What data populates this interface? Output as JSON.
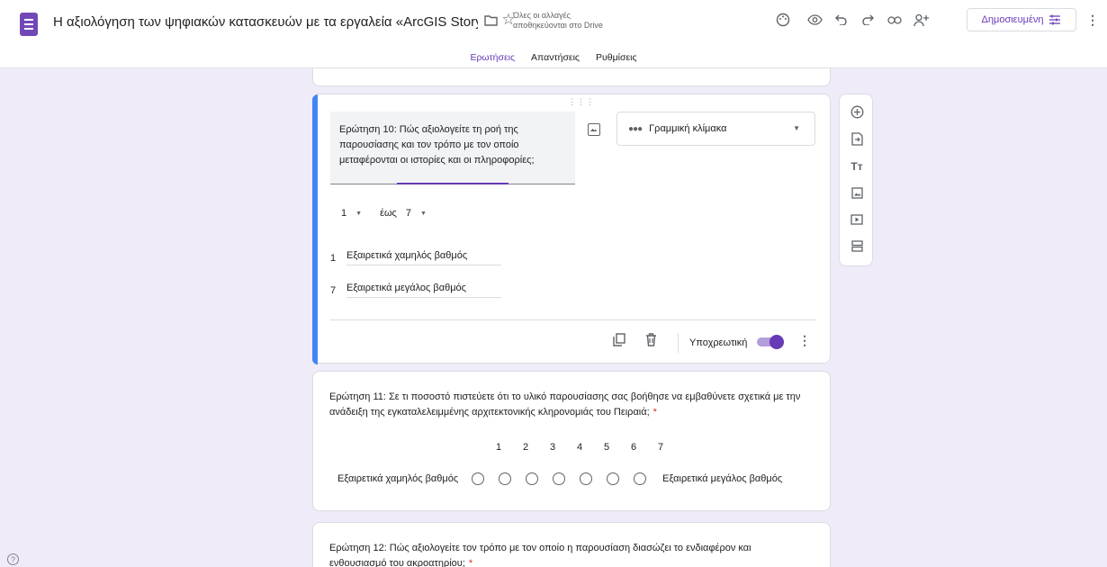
{
  "header": {
    "title": "Η αξιολόγηση των ψηφιακών κατασκευών με τα εργαλεία «ArcGIS Story",
    "save_status_line1": "Όλες οι αλλαγές",
    "save_status_line2": "αποθηκεύονται στο Drive",
    "publish_label": "Δημοσιευμένη",
    "icons": [
      "palette-icon",
      "preview-icon",
      "undo-icon",
      "redo-icon",
      "link-icon",
      "add-collaborator-icon",
      "more-vert-icon"
    ]
  },
  "tabs": [
    {
      "label": "Ερωτήσεις",
      "active": true
    },
    {
      "label": "Απαντήσεις",
      "active": false
    },
    {
      "label": "Ρυθμίσεις",
      "active": false
    }
  ],
  "active_question": {
    "title": "Ερώτηση 10: Πώς αξιολογείτε τη ροή της παρουσίασης και τον τρόπο με τον οποίο μεταφέρονται οι ιστορίες και οι πληροφορίες;",
    "type_label": "Γραμμική κλίμακα",
    "range_from": "1",
    "range_to_word": "έως",
    "range_to": "7",
    "low_num": "1",
    "low_label": "Εξαιρετικά χαμηλός βαθμός",
    "high_num": "7",
    "high_label": "Εξαιρετικά μεγάλος βαθμός",
    "required_label": "Υποχρεωτική",
    "required": true
  },
  "question_11": {
    "title": "Ερώτηση 11: Σε τι ποσοστό πιστεύετε ότι το υλικό παρουσίασης σας βοήθησε να εμβαθύνετε σχετικά με την ανάδειξη της εγκαταλελειμμένης αρχιτεκτονικής κληρονομιάς του Πειραιά;",
    "required_star": "*",
    "scale": [
      "1",
      "2",
      "3",
      "4",
      "5",
      "6",
      "7"
    ],
    "low_label": "Εξαιρετικά χαμηλός βαθμός",
    "high_label": "Εξαιρετικά μεγάλος βαθμός"
  },
  "question_12": {
    "title": "Ερώτηση 12: Πώς αξιολογείτε τον τρόπο με τον οποίο η παρουσίαση διασώζει το ενδιαφέρον και ενθουσιασμό του ακροατηρίου;",
    "required_star": "*"
  },
  "colors": {
    "accent": "#673ab7",
    "background": "#f0ebf8",
    "active_bar": "#4285f4",
    "required": "#d93025"
  }
}
